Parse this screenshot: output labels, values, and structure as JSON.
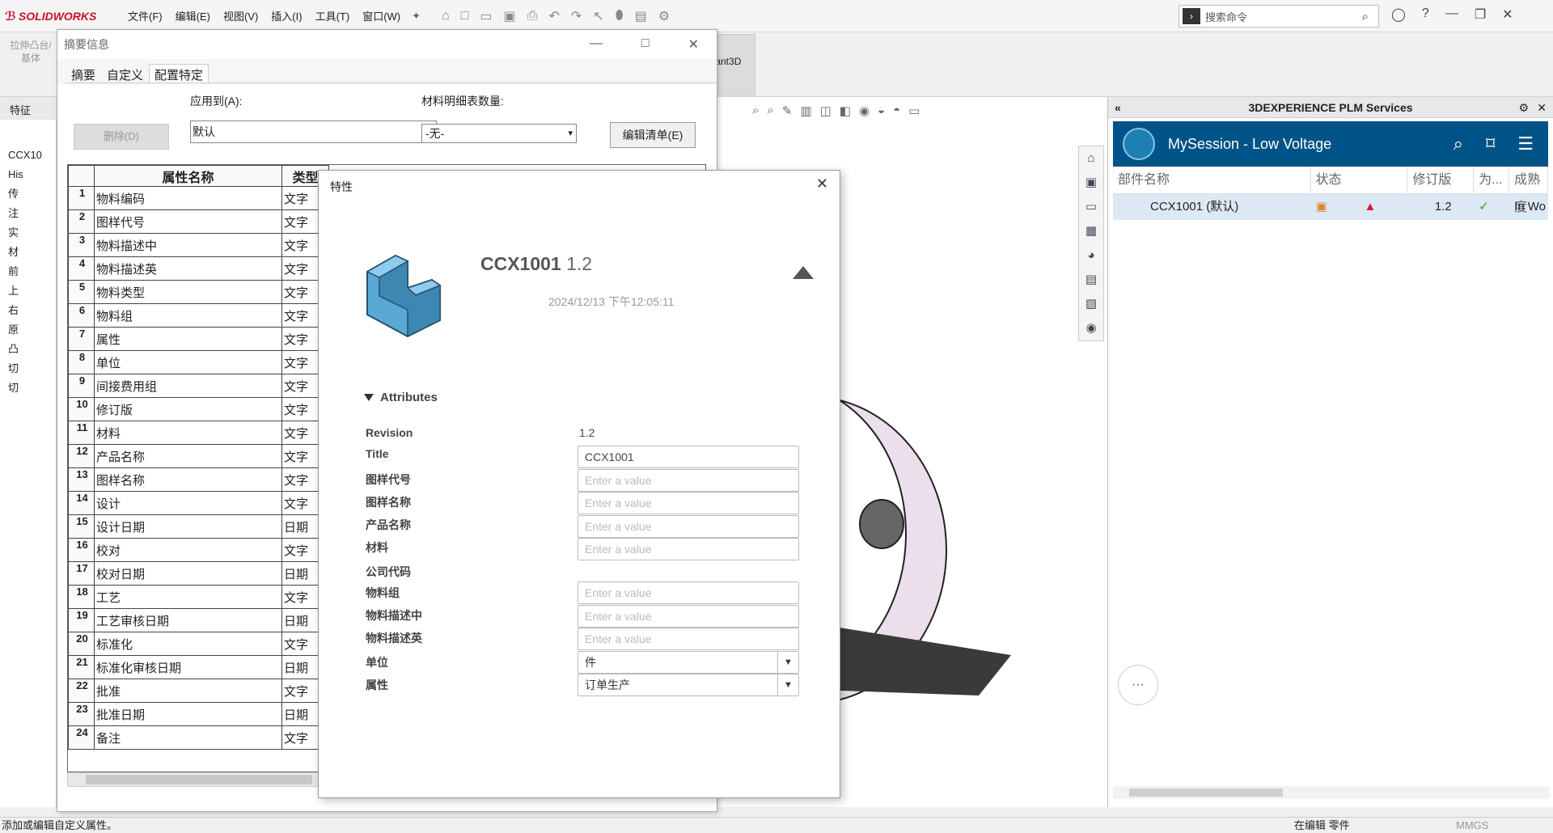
{
  "app": {
    "brand": "SOLIDWORKS",
    "menu": [
      "文件(F)",
      "编辑(E)",
      "视图(V)",
      "插入(I)",
      "工具(T)",
      "窗口(W)"
    ],
    "search_placeholder": "搜索命令"
  },
  "ribbon": {
    "extrude_label": "拉伸凸台/基体",
    "instant3d_label": "tant3D"
  },
  "left_panel": {
    "tab": "特征",
    "tree": [
      "CCX10",
      "His",
      "传",
      "注",
      "实",
      "材",
      "前",
      "上",
      "右",
      "原",
      "凸",
      "切",
      "切"
    ]
  },
  "plm": {
    "header": "3DEXPERIENCE PLM Services",
    "session": "MySession - Low Voltage",
    "columns": [
      "部件名称",
      "状态",
      "修订版",
      "为...",
      "成熟度"
    ],
    "row": {
      "name": "CCX1001 (默认)",
      "revision": "1.2",
      "maturity": "In Wo"
    }
  },
  "status_bar": {
    "message": "添加或编辑自定义属性。",
    "editing": "在编辑 零件",
    "units": "MMGS"
  },
  "summary": {
    "title": "摘要信息",
    "tabs": [
      "摘要",
      "自定义",
      "配置特定"
    ],
    "apply_label": "应用到(A):",
    "qty_label": "材料明细表数量:",
    "delete_btn": "删除(D)",
    "apply_value": "默认",
    "qty_value": "-无-",
    "edit_btn": "编辑清单(E)",
    "col_name": "属性名称",
    "col_type": "类型",
    "rows": [
      {
        "n": "1",
        "name": "物料编码",
        "type": "文字"
      },
      {
        "n": "2",
        "name": "图样代号",
        "type": "文字"
      },
      {
        "n": "3",
        "name": "物料描述中",
        "type": "文字"
      },
      {
        "n": "4",
        "name": "物料描述英",
        "type": "文字"
      },
      {
        "n": "5",
        "name": "物料类型",
        "type": "文字"
      },
      {
        "n": "6",
        "name": "物料组",
        "type": "文字"
      },
      {
        "n": "7",
        "name": "属性",
        "type": "文字"
      },
      {
        "n": "8",
        "name": "单位",
        "type": "文字"
      },
      {
        "n": "9",
        "name": "间接费用组",
        "type": "文字"
      },
      {
        "n": "10",
        "name": "修订版",
        "type": "文字"
      },
      {
        "n": "11",
        "name": "材料",
        "type": "文字"
      },
      {
        "n": "12",
        "name": "产品名称",
        "type": "文字"
      },
      {
        "n": "13",
        "name": "图样名称",
        "type": "文字"
      },
      {
        "n": "14",
        "name": "设计",
        "type": "文字"
      },
      {
        "n": "15",
        "name": "设计日期",
        "type": "日期"
      },
      {
        "n": "16",
        "name": "校对",
        "type": "文字"
      },
      {
        "n": "17",
        "name": "校对日期",
        "type": "日期"
      },
      {
        "n": "18",
        "name": "工艺",
        "type": "文字"
      },
      {
        "n": "19",
        "name": "工艺审核日期",
        "type": "日期"
      },
      {
        "n": "20",
        "name": "标准化",
        "type": "文字"
      },
      {
        "n": "21",
        "name": "标准化审核日期",
        "type": "日期"
      },
      {
        "n": "22",
        "name": "批准",
        "type": "文字"
      },
      {
        "n": "23",
        "name": "批准日期",
        "type": "日期"
      },
      {
        "n": "24",
        "name": "备注",
        "type": "文字"
      }
    ]
  },
  "props": {
    "title": "特性",
    "part_name": "CCX1001",
    "revision": "1.2",
    "date": "2024/12/13 下午12:05:11",
    "attributes_label": "Attributes",
    "placeholder": "Enter a value",
    "fields": {
      "revision": "Revision",
      "title": "Title",
      "drawing_code": "图样代号",
      "drawing_name": "图样名称",
      "product_name": "产品名称",
      "material": "材料",
      "company_code": "公司代码",
      "material_group": "物料组",
      "desc_cn": "物料描述中",
      "desc_en": "物料描述英",
      "unit": "单位",
      "attribute": "属性"
    },
    "values": {
      "revision": "1.2",
      "title": "CCX1001",
      "unit": "件",
      "attribute": "订单生产"
    }
  }
}
